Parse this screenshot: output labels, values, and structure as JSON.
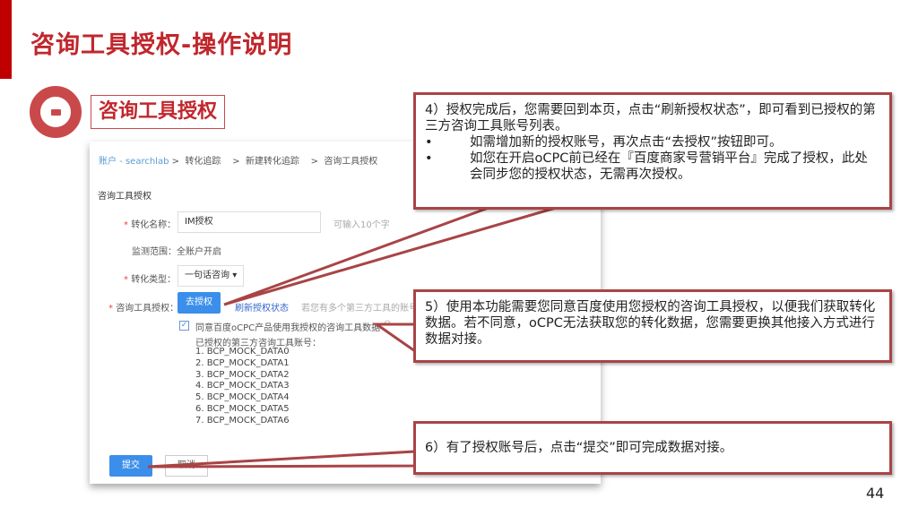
{
  "slide": {
    "title": "咨询工具授权-操作说明",
    "section_title": "咨询工具授权",
    "page_number": "44",
    "accent_color": "#c0272d"
  },
  "screenshot": {
    "breadcrumb": {
      "account": "账户 - searchlab",
      "sep": ">",
      "items": [
        "转化追踪",
        "新建转化追踪",
        "咨询工具授权"
      ]
    },
    "heading": "咨询工具授权",
    "name_label": "转化名称：",
    "name_value": "IM授权",
    "name_hint": "可输入10个字",
    "scope_label": "监测范围：",
    "scope_value": "全账户开启",
    "type_label": "转化类型：",
    "type_value": "一句话咨询",
    "auth_label": "咨询工具授权：",
    "auth_button": "去授权",
    "refresh_link": "刷新授权状态",
    "auth_hint": "若您有多个第三方工具的账号",
    "agree_text": "同意百度oCPC产品使用我授权的咨询工具数据",
    "agree_checked": true,
    "accounts_label": "已授权的第三方咨询工具账号：",
    "accounts": [
      "1. BCP_MOCK_DATA0",
      "2. BCP_MOCK_DATA1",
      "3. BCP_MOCK_DATA2",
      "4. BCP_MOCK_DATA3",
      "5. BCP_MOCK_DATA4",
      "6. BCP_MOCK_DATA5",
      "7. BCP_MOCK_DATA6"
    ],
    "submit_button": "提交",
    "cancel_button": "取消"
  },
  "callouts": {
    "step4": {
      "text": "4）授权完成后，您需要回到本页，点击“刷新授权状态”，即可看到已授权的第三方咨询工具账号列表。",
      "bullets": [
        "如需增加新的授权账号，再次点击“去授权”按钮即可。",
        "如您在开启oCPC前已经在『百度商家号营销平台』完成了授权，此处会同步您的授权状态，无需再次授权。"
      ]
    },
    "step5": {
      "text": "5）使用本功能需要您同意百度使用您授权的咨询工具授权，以便我们获取转化数据。若不同意，oCPC无法获取您的转化数据，您需要更换其他接入方式进行数据对接。"
    },
    "step6": {
      "text": "6）有了授权账号后，点击“提交”即可完成数据对接。"
    }
  }
}
